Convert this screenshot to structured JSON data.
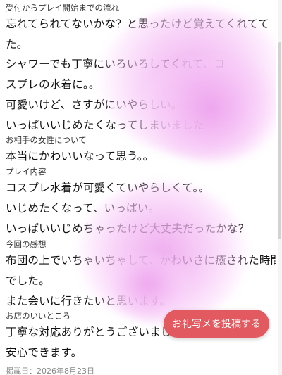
{
  "review": {
    "section_flow_heading": "受付からプレイ開始までの流れ",
    "flow_lines": [
      "忘れてられてないかな？と思ったけど覚えてくれてて",
      "た。",
      "シャワーでも丁寧にいろいろしてくれて、コ",
      "スプレの水着に。。",
      "可愛いけど、さすがにいやらしい。",
      "いっぱいいじめたくなってしまいました"
    ],
    "section_girl_heading": "お相手の女性について",
    "girl_lines": [
      "本当にかわいいなって思う。。"
    ],
    "section_play_heading": "プレイ内容",
    "play_lines": [
      "コスプレ水着が可愛くていやらしくて。。",
      "いじめたくなって、いっぱい。",
      "いっぱいいじめちゃったけど大丈夫だったかな？"
    ],
    "section_impression_heading": "今回の感想",
    "impression_lines": [
      "布団の上でいちゃいちゃして、かわいさに癒された時間",
      "でした。",
      "また会いに行きたいと思います。"
    ],
    "section_shop_heading": "お店のいいところ",
    "shop_lines": [
      "丁寧な対応ありがとうございました",
      "安心できます。"
    ],
    "date_text": "掲載日：2026年8月23日"
  },
  "post_button": {
    "label": "お礼写メを投稿する"
  },
  "colors": {
    "button_bg": "#e25a5f",
    "blob_pink": "#eca0ec"
  }
}
